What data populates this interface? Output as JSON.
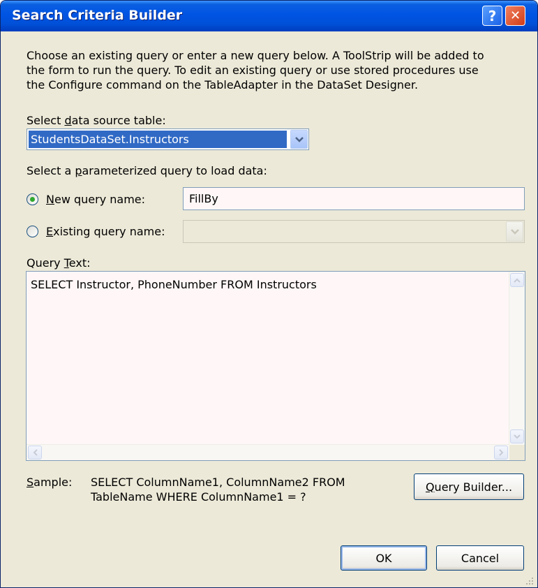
{
  "window": {
    "title": "Search Criteria Builder",
    "help_button_label": "?",
    "close_button_label": "✕"
  },
  "description": [
    "Choose an existing query or enter a new query below. A ToolStrip will be added to",
    "the form to run the query. To edit an existing query or use stored procedures use",
    "the Configure command on the TableAdapter in the DataSet Designer."
  ],
  "data_source": {
    "label_pre": "Select ",
    "label_accel": "d",
    "label_post": "ata source table:",
    "selected": "StudentsDataSet.Instructors"
  },
  "query_select": {
    "label_pre": "Select a ",
    "label_accel": "p",
    "label_post": "arameterized query to load data:"
  },
  "new_query": {
    "label_accel": "N",
    "label_post": "ew query name:",
    "value": "FillBy",
    "checked": true
  },
  "existing_query": {
    "label_accel": "E",
    "label_post": "xisting query name:",
    "value": "",
    "checked": false
  },
  "query_text": {
    "label_pre": "Query ",
    "label_accel": "T",
    "label_post": "ext:",
    "value": "SELECT Instructor, PhoneNumber FROM Instructors"
  },
  "sample": {
    "label_accel": "S",
    "label_post": "ample:",
    "line1": "SELECT ColumnName1, ColumnName2 FROM",
    "line2": "TableName WHERE ColumnName1 = ?"
  },
  "buttons": {
    "query_builder_accel": "Q",
    "query_builder_post": "uery Builder...",
    "ok": "OK",
    "cancel": "Cancel"
  },
  "colors": {
    "titlebar": "#0054e3",
    "dialog_bg": "#ece9d8",
    "selection": "#316ac5",
    "radio_dot": "#2fa82f"
  }
}
